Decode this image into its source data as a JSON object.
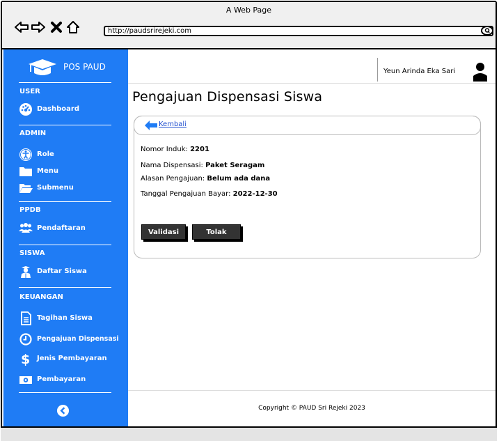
{
  "browser": {
    "window_title": "A Web Page",
    "url": "http://paudsrirejeki.com"
  },
  "sidebar": {
    "brand": "POS PAUD",
    "sections": [
      {
        "title": "USER",
        "items": [
          {
            "label": "Dashboard",
            "icon": "dashboard-icon"
          }
        ]
      },
      {
        "title": "ADMIN",
        "items": [
          {
            "label": "Role",
            "icon": "accessibility-icon"
          },
          {
            "label": "Menu",
            "icon": "folder-icon"
          },
          {
            "label": "Submenu",
            "icon": "folder-open-icon"
          }
        ]
      },
      {
        "title": "PPDB",
        "items": [
          {
            "label": "Pendaftaran",
            "icon": "users-icon"
          }
        ]
      },
      {
        "title": "SISWA",
        "items": [
          {
            "label": "Daftar Siswa",
            "icon": "student-icon"
          }
        ]
      },
      {
        "title": "KEUANGAN",
        "items": [
          {
            "label": "Tagihan Siswa",
            "icon": "document-icon"
          },
          {
            "label": "Pengajuan Dispensasi",
            "icon": "clock-icon"
          },
          {
            "label": "Jenis Pembayaran",
            "icon": "dollar-icon"
          },
          {
            "label": "Pembayaran",
            "icon": "money-icon"
          }
        ]
      }
    ]
  },
  "topbar": {
    "user_name": "Yeun Arinda Eka Sari"
  },
  "main": {
    "title": "Pengajuan Dispensasi Siswa",
    "back_label": "Kembali",
    "fields": [
      {
        "label": "Nomor Induk:",
        "value": "2201"
      },
      {
        "label": "Nama Dispensasi:",
        "value": "Paket Seragam"
      },
      {
        "label": "Alasan Pengajuan:",
        "value": "Belum ada dana"
      },
      {
        "label": "Tanggal Pengajuan Bayar:",
        "value": "2022-12-30"
      }
    ],
    "validate_label": "Validasi",
    "reject_label": "Tolak"
  },
  "footer": {
    "text": "Copyright © PAUD Sri Rejeki 2023"
  },
  "colors": {
    "sidebar": "#1f7cf5",
    "button": "#333333",
    "link": "#1f4ecf"
  }
}
